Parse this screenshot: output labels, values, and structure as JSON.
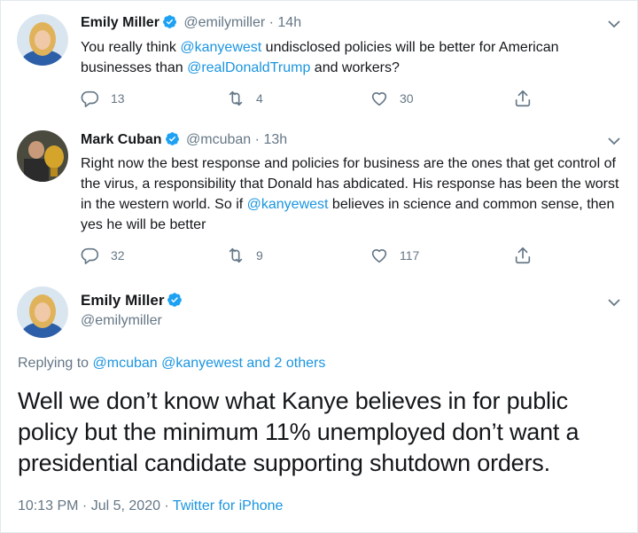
{
  "tweets": [
    {
      "name": "Emily Miller",
      "handle": "@emilymiller",
      "sep": "·",
      "time": "14h",
      "text_parts": [
        {
          "text": "You really think ",
          "mention": false
        },
        {
          "text": "@kanyewest",
          "mention": true
        },
        {
          "text": " undisclosed policies will be better for American businesses than ",
          "mention": false
        },
        {
          "text": "@realDonaldTrump",
          "mention": true
        },
        {
          "text": " and workers?",
          "mention": false
        }
      ],
      "replies": "13",
      "retweets": "4",
      "likes": "30"
    },
    {
      "name": "Mark Cuban",
      "handle": "@mcuban",
      "sep": "·",
      "time": "13h",
      "text_parts": [
        {
          "text": "Right now the best response and policies for business are the ones that get control of the virus, a responsibility that Donald has abdicated. His response has been the worst in the western world. So if ",
          "mention": false
        },
        {
          "text": "@kanyewest",
          "mention": true
        },
        {
          "text": " believes in science and common sense, then yes he will be better",
          "mention": false
        }
      ],
      "replies": "32",
      "retweets": "9",
      "likes": "117"
    }
  ],
  "main_tweet": {
    "name": "Emily Miller",
    "handle": "@emilymiller",
    "replying_label": "Replying to ",
    "replying_targets": "@mcuban @kanyewest and 2 others",
    "text": "Well we don’t know what Kanye believes in for public policy but the minimum 11% unemployed don’t want a presidential candidate supporting shutdown orders.",
    "timestamp": "10:13 PM · Jul 5, 2020 · ",
    "source": "Twitter for iPhone"
  },
  "icons": {
    "verified": "verified-badge-icon",
    "chevron": "chevron-down-icon",
    "reply": "reply-icon",
    "retweet": "retweet-icon",
    "like": "heart-icon",
    "share": "share-icon"
  },
  "colors": {
    "link": "#1b95e0",
    "muted": "#657786",
    "verified": "#1da1f2"
  }
}
